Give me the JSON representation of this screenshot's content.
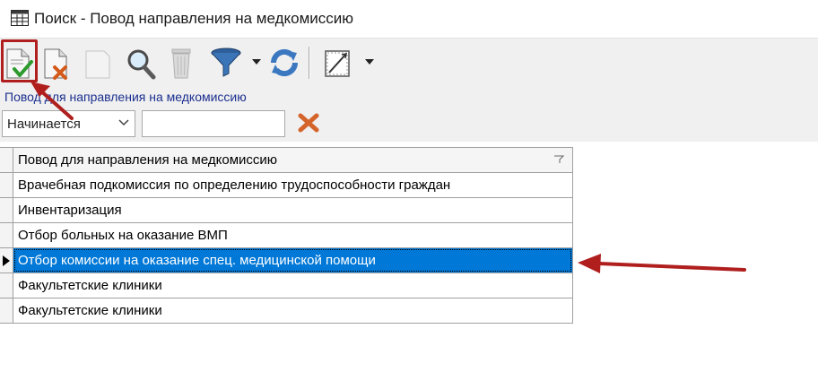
{
  "window": {
    "title": "Поиск - Повод направления на медкомиссию"
  },
  "toolbar": {
    "buttons": [
      {
        "name": "select-confirm-button",
        "icon": "document-check-icon",
        "enabled": true
      },
      {
        "name": "delete-button",
        "icon": "document-x-icon",
        "enabled": true
      },
      {
        "name": "blank-doc-button",
        "icon": "blank-document-icon",
        "enabled": false
      },
      {
        "name": "find-button",
        "icon": "magnifier-icon",
        "enabled": true
      },
      {
        "name": "trash-button",
        "icon": "trash-icon",
        "enabled": false
      },
      {
        "name": "filter-button",
        "icon": "funnel-icon",
        "enabled": true
      },
      {
        "name": "refresh-button",
        "icon": "refresh-icon",
        "enabled": true
      },
      {
        "name": "layout-button",
        "icon": "frame-icon",
        "enabled": true
      }
    ]
  },
  "filter": {
    "label": "Повод для направления на медкомиссию",
    "mode": "Начинается",
    "value": ""
  },
  "grid": {
    "column": "Повод для направления на медкомиссию",
    "rows": [
      "Врачебная подкомиссия по определению трудоспособности граждан",
      "Инвентаризация",
      "Отбор больных на оказание ВМП",
      "Отбор комиссии на оказание спец. медицинской помощи",
      "Факультетские клиники",
      "Факультетские клиники"
    ],
    "selected_index": 3
  },
  "colors": {
    "selection": "#0078d7",
    "annotation": "#b01e1e",
    "label": "#1b2f8e"
  }
}
